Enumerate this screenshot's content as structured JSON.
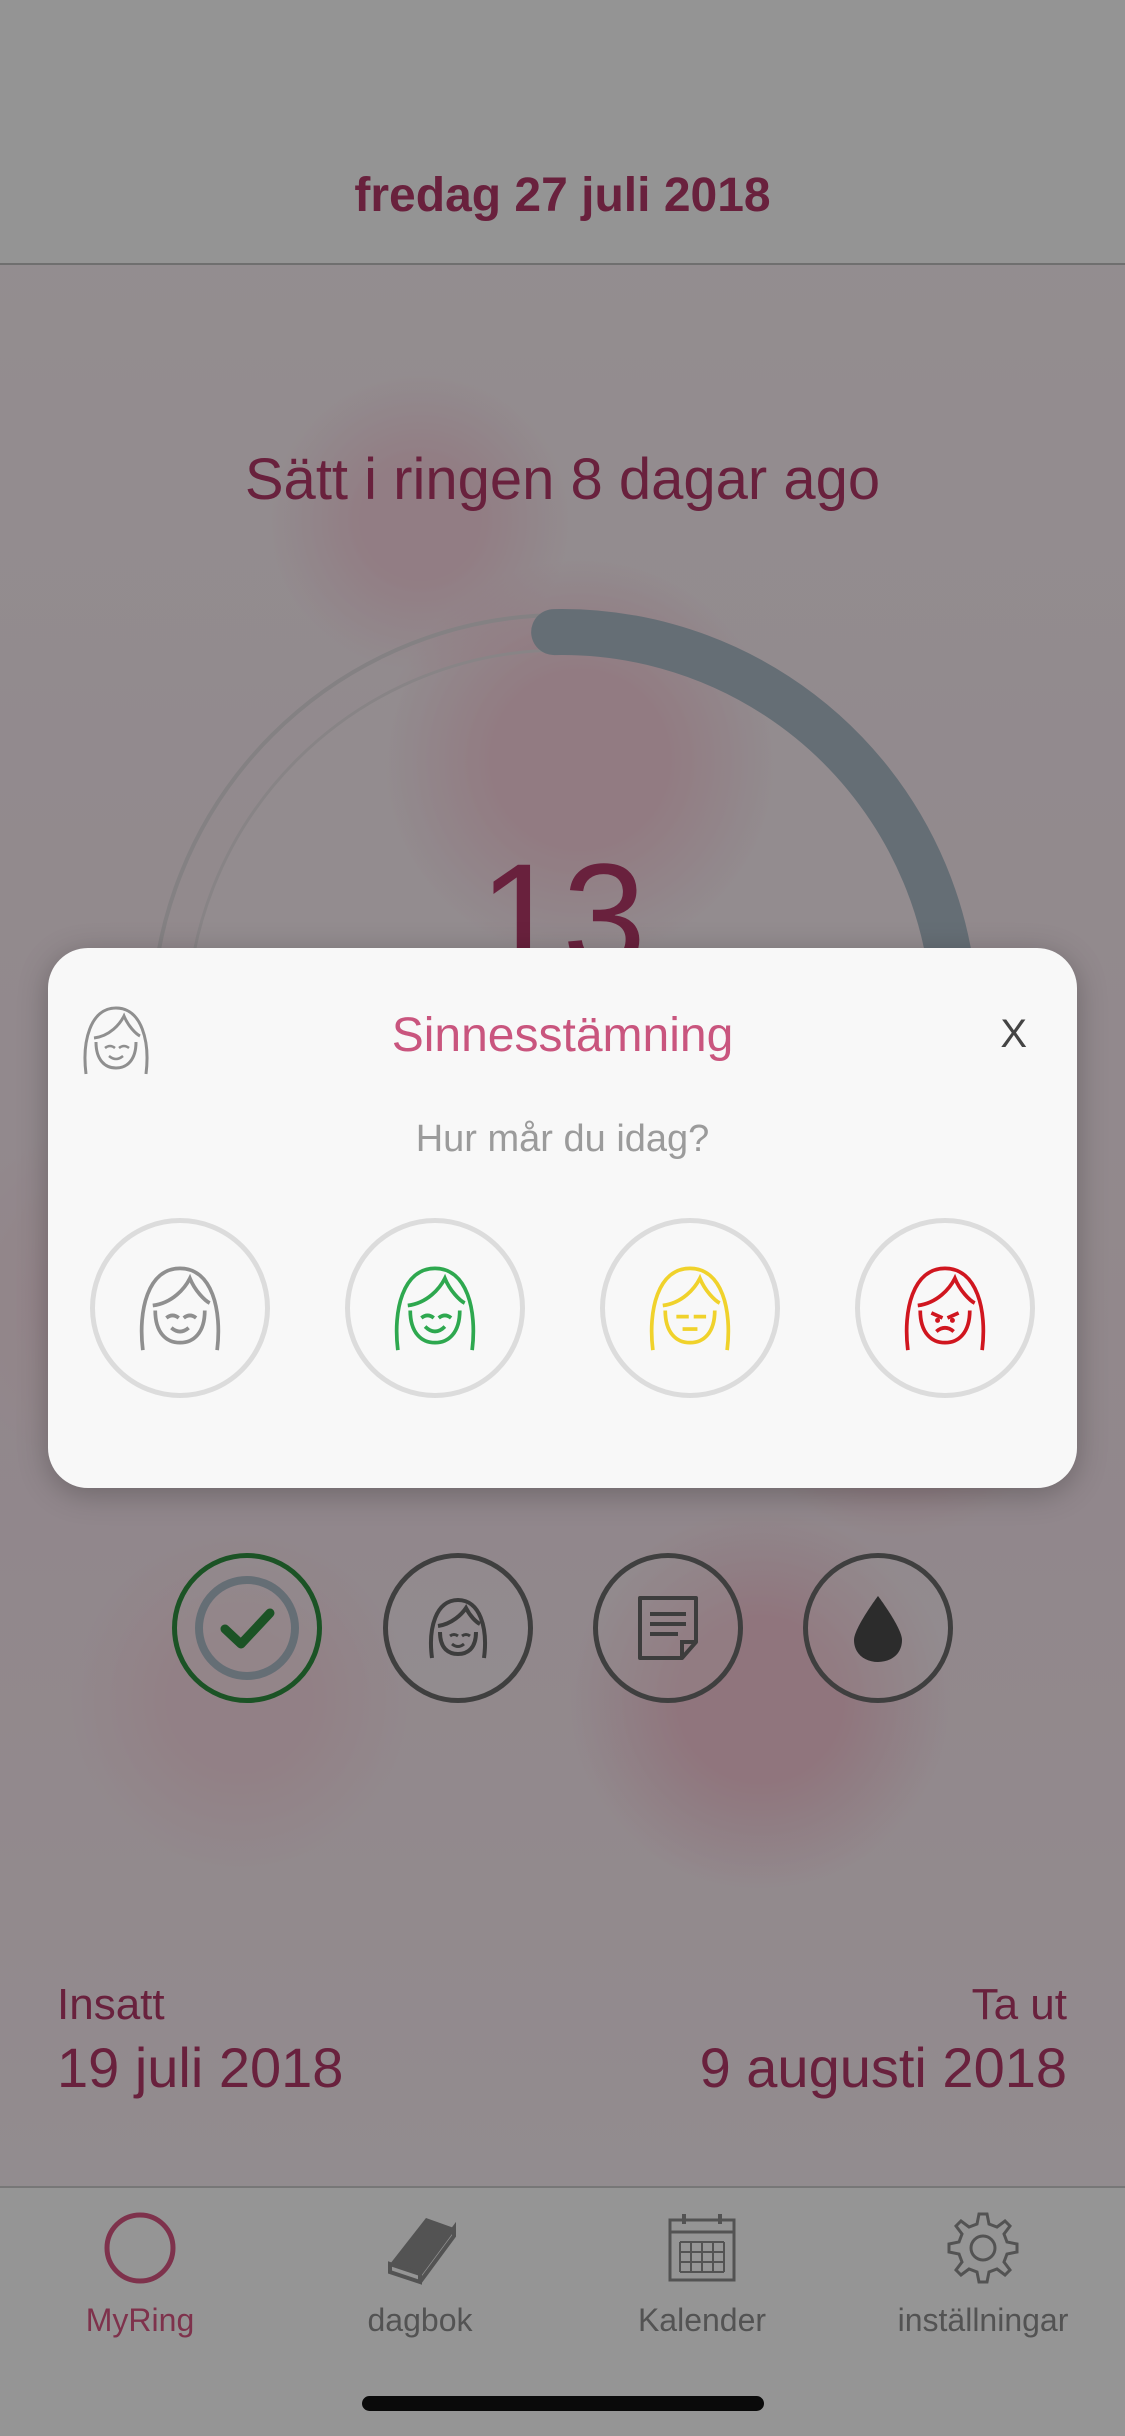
{
  "header": {
    "date": "fredag 27 juli 2018"
  },
  "main": {
    "status_text": "Sätt i ringen 8 dagar ago",
    "day_count": "13",
    "ring_progress": 0.38
  },
  "actions": [
    {
      "name": "checkmark-icon",
      "done": true
    },
    {
      "name": "mood-face-icon",
      "done": false
    },
    {
      "name": "notes-icon",
      "done": false
    },
    {
      "name": "drop-icon",
      "done": false
    }
  ],
  "dates": {
    "inserted_label": "Insatt",
    "inserted_date": "19 juli 2018",
    "removal_label": "Ta ut",
    "removal_date": "9 augusti 2018"
  },
  "modal": {
    "title": "Sinnesstämning",
    "close_label": "X",
    "question": "Hur mår du idag?",
    "moods": [
      {
        "icon": "neutral-face-icon",
        "color": "#8f8f8f"
      },
      {
        "icon": "happy-face-icon",
        "color": "#2ea84f"
      },
      {
        "icon": "meh-face-icon",
        "color": "#f0d22b"
      },
      {
        "icon": "sad-face-icon",
        "color": "#d0161f"
      }
    ]
  },
  "tabs": [
    {
      "label": "MyRing",
      "icon": "ring-icon",
      "active": true
    },
    {
      "label": "dagbok",
      "icon": "book-icon",
      "active": false
    },
    {
      "label": "Kalender",
      "icon": "calendar-icon",
      "active": false
    },
    {
      "label": "inställningar",
      "icon": "gear-icon",
      "active": false
    }
  ],
  "colors": {
    "accent": "#b03766",
    "tab_active": "#d3547f",
    "done_green": "#2e8b3e"
  }
}
